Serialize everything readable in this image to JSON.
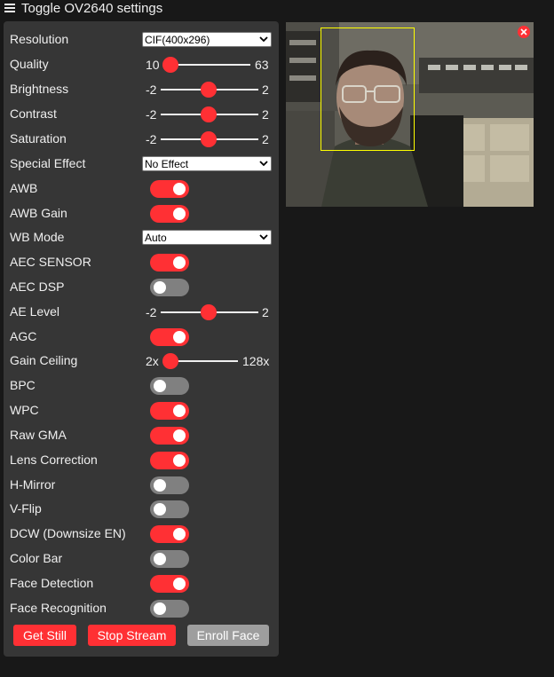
{
  "title": "Toggle OV2640 settings",
  "settings": {
    "resolution": {
      "label": "Resolution",
      "value": "CIF(400x296)"
    },
    "quality": {
      "label": "Quality",
      "min": "10",
      "max": "63",
      "value": 10
    },
    "brightness": {
      "label": "Brightness",
      "min": "-2",
      "max": "2",
      "value": 0
    },
    "contrast": {
      "label": "Contrast",
      "min": "-2",
      "max": "2",
      "value": 0
    },
    "saturation": {
      "label": "Saturation",
      "min": "-2",
      "max": "2",
      "value": 0
    },
    "special_effect": {
      "label": "Special Effect",
      "value": "No Effect"
    },
    "awb": {
      "label": "AWB",
      "on": true
    },
    "awb_gain": {
      "label": "AWB Gain",
      "on": true
    },
    "wb_mode": {
      "label": "WB Mode",
      "value": "Auto"
    },
    "aec_sensor": {
      "label": "AEC SENSOR",
      "on": true
    },
    "aec_dsp": {
      "label": "AEC DSP",
      "on": false
    },
    "ae_level": {
      "label": "AE Level",
      "min": "-2",
      "max": "2",
      "value": 0
    },
    "agc": {
      "label": "AGC",
      "on": true
    },
    "gain_ceiling": {
      "label": "Gain Ceiling",
      "min": "2x",
      "max": "128x",
      "value": 0
    },
    "bpc": {
      "label": "BPC",
      "on": false
    },
    "wpc": {
      "label": "WPC",
      "on": true
    },
    "raw_gma": {
      "label": "Raw GMA",
      "on": true
    },
    "lens_correction": {
      "label": "Lens Correction",
      "on": true
    },
    "h_mirror": {
      "label": "H-Mirror",
      "on": false
    },
    "v_flip": {
      "label": "V-Flip",
      "on": false
    },
    "dcw": {
      "label": "DCW (Downsize EN)",
      "on": true
    },
    "color_bar": {
      "label": "Color Bar",
      "on": false
    },
    "face_detection": {
      "label": "Face Detection",
      "on": true
    },
    "face_recognition": {
      "label": "Face Recognition",
      "on": false
    }
  },
  "buttons": {
    "get_still": "Get Still",
    "stop_stream": "Stop Stream",
    "enroll_face": "Enroll Face"
  },
  "colors": {
    "accent": "#ff3034",
    "panel": "#363636",
    "background": "#181818",
    "switch_off": "#808080",
    "face_box": "#ffff00"
  },
  "icons": {
    "menu": "hamburger-icon",
    "close": "close-icon",
    "dropdown": "chevron-down-icon"
  },
  "stream": {
    "face_detected": true
  }
}
